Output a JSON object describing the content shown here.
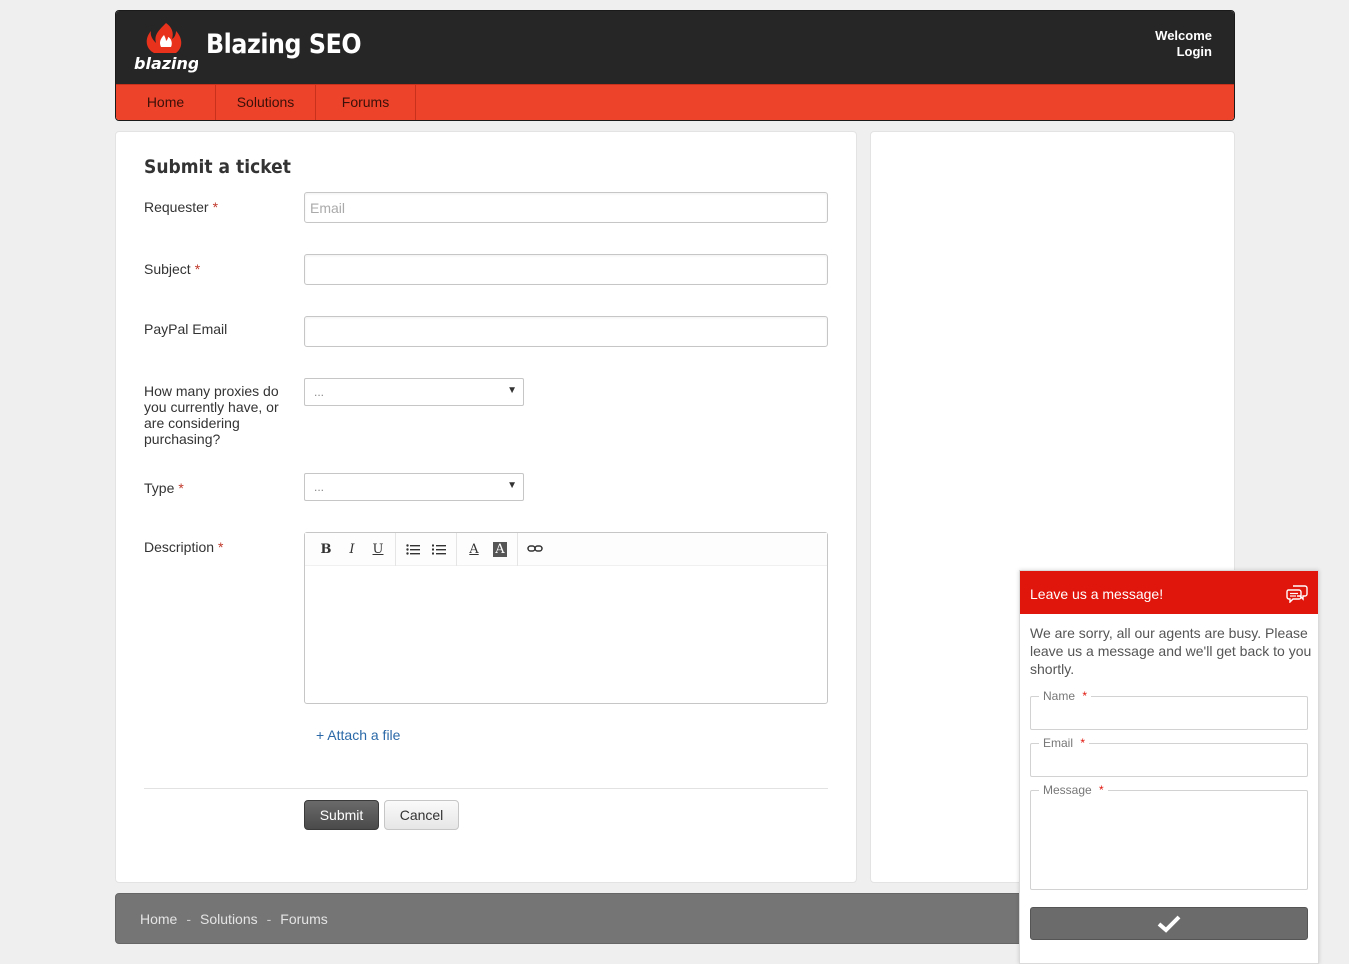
{
  "header": {
    "brand": "Blazing SEO",
    "logo_text": "blazing",
    "welcome": "Welcome",
    "login": "Login"
  },
  "nav": [
    "Home",
    "Solutions",
    "Forums"
  ],
  "form": {
    "title": "Submit a ticket",
    "requester_label": "Requester",
    "requester_placeholder": "Email",
    "subject_label": "Subject",
    "paypal_label": "PayPal Email",
    "proxies_label": "How many proxies do you currently have, or are considering purchasing?",
    "proxies_value": "...",
    "type_label": "Type",
    "type_value": "...",
    "description_label": "Description",
    "required_mark": "*",
    "attach": "+ Attach a file",
    "submit": "Submit",
    "cancel": "Cancel"
  },
  "toolbar": {
    "bold": "B",
    "italic": "I",
    "underline": "U",
    "font_color": "A",
    "highlight": "A"
  },
  "footer": {
    "links": [
      "Home",
      "Solutions",
      "Forums"
    ],
    "separator": "-"
  },
  "chat": {
    "title": "Leave us a message!",
    "message": "We are sorry, all our agents are busy. Please leave us a message and we'll get back to you shortly.",
    "name_label": "Name",
    "email_label": "Email",
    "message_label": "Message",
    "required_mark": "*"
  },
  "colors": {
    "nav_red": "#ee432b",
    "header_dark": "#262626",
    "chat_red": "#e0150c",
    "footer_gray": "#757575"
  }
}
